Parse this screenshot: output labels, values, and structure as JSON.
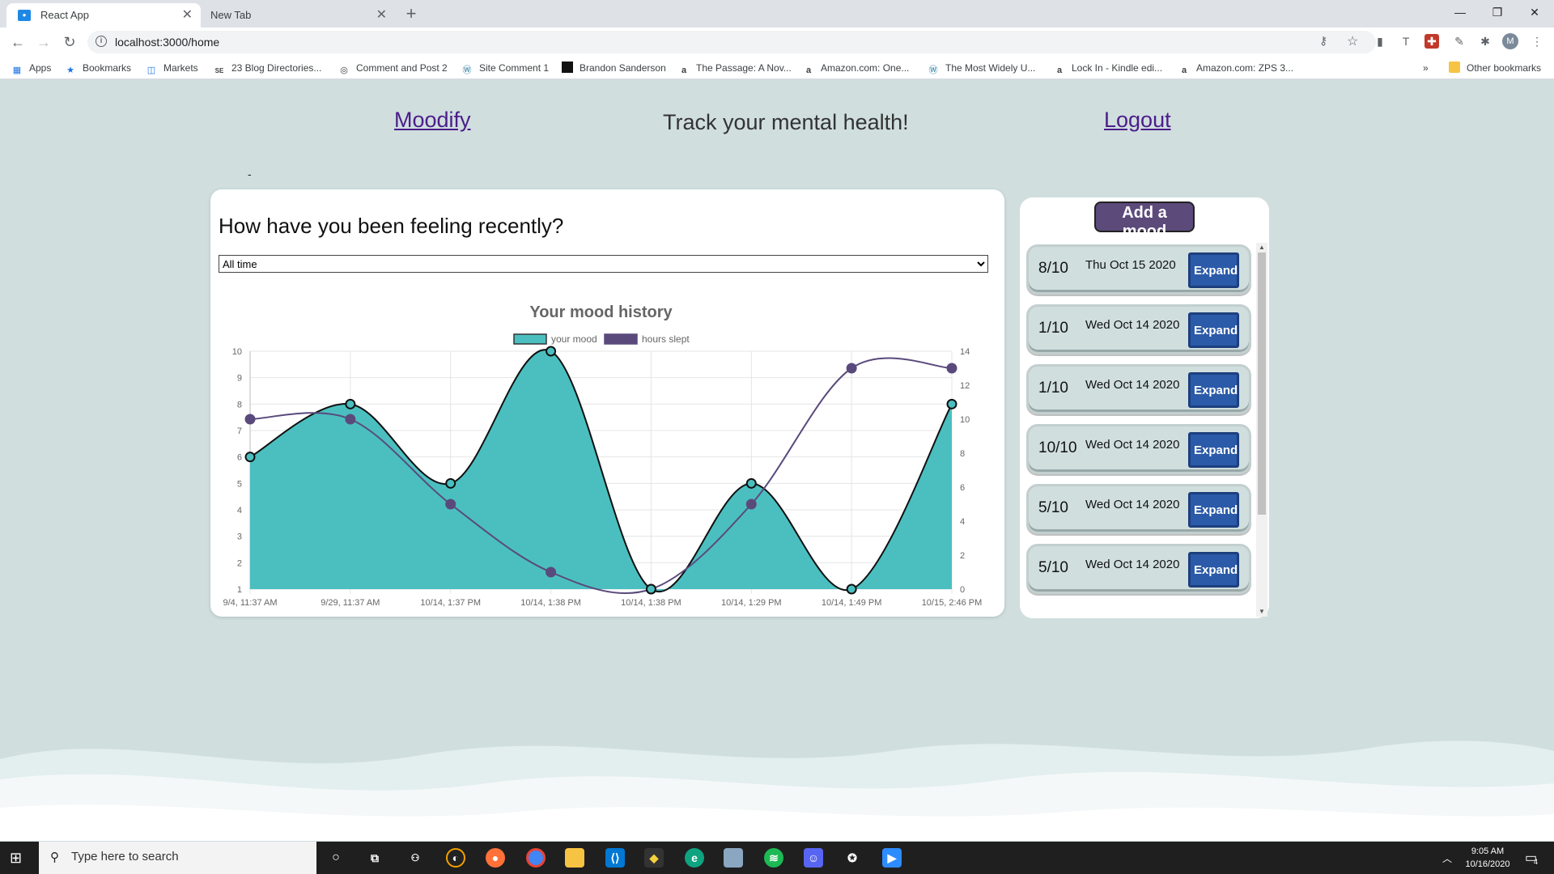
{
  "browser": {
    "tabs": [
      {
        "title": "React App",
        "active": true
      },
      {
        "title": "New Tab",
        "active": false
      }
    ],
    "url": "localhost:3000/home",
    "bookmarks": [
      {
        "label": "Apps",
        "icon": "apps-grid-icon"
      },
      {
        "label": "Bookmarks",
        "icon": "star-icon"
      },
      {
        "label": "Markets",
        "icon": "markets-icon"
      },
      {
        "label": "23 Blog Directories...",
        "icon": "seo-icon"
      },
      {
        "label": "Comment and Post 2",
        "icon": "globe-icon"
      },
      {
        "label": "Site Comment 1",
        "icon": "wordpress-icon"
      },
      {
        "label": "Brandon Sanderson",
        "icon": "black-square-icon"
      },
      {
        "label": "The Passage: A Nov...",
        "icon": "amazon-icon"
      },
      {
        "label": "Amazon.com: One...",
        "icon": "amazon-icon"
      },
      {
        "label": "The Most Widely U...",
        "icon": "wordpress-icon"
      },
      {
        "label": "Lock In - Kindle edi...",
        "icon": "amazon-icon"
      },
      {
        "label": "Amazon.com: ZPS 3...",
        "icon": "amazon-icon"
      }
    ],
    "bookmarks_overflow": "»",
    "other_bookmarks": "Other bookmarks",
    "profile_initial": "M"
  },
  "header": {
    "brand": "Moodify",
    "tagline": "Track your mental health!",
    "logout": "Logout",
    "stray_mark": "-"
  },
  "main": {
    "question": "How have you been feeling recently?",
    "range_selected": "All time"
  },
  "chart_data": {
    "type": "line",
    "title": "Your mood history",
    "categories": [
      "9/4, 11:37 AM",
      "9/29, 11:37 AM",
      "10/14, 1:37 PM",
      "10/14, 1:38 PM",
      "10/14, 1:38 PM",
      "10/14, 1:29 PM",
      "10/14, 1:49 PM",
      "10/15, 2:46 PM"
    ],
    "series": [
      {
        "name": "your mood",
        "values": [
          6,
          8,
          5,
          10,
          1,
          5,
          1,
          8
        ],
        "color": "#4bbfc0",
        "fill": true,
        "axis": "left"
      },
      {
        "name": "hours slept",
        "values": [
          10,
          10,
          5,
          1,
          0,
          5,
          13,
          13
        ],
        "color": "#5a4a7c",
        "fill": false,
        "axis": "right"
      }
    ],
    "ylim_left": [
      1,
      10
    ],
    "ylim_right": [
      0,
      14
    ],
    "yticks_left": [
      "1",
      "2",
      "3",
      "4",
      "5",
      "6",
      "7",
      "8",
      "9",
      "10"
    ],
    "yticks_right": [
      "0",
      "2",
      "4",
      "6",
      "8",
      "10",
      "12",
      "14"
    ],
    "legend_position": "top",
    "grid": true
  },
  "side": {
    "add_label": "Add a mood",
    "expand_label": "Expand",
    "moods": [
      {
        "score": "8/10",
        "date": "Thu Oct 15 2020"
      },
      {
        "score": "1/10",
        "date": "Wed Oct 14 2020"
      },
      {
        "score": "1/10",
        "date": "Wed Oct 14 2020"
      },
      {
        "score": "10/10",
        "date": "Wed Oct 14 2020"
      },
      {
        "score": "5/10",
        "date": "Wed Oct 14 2020"
      },
      {
        "score": "5/10",
        "date": "Wed Oct 14 2020"
      }
    ]
  },
  "taskbar": {
    "search_placeholder": "Type here to search",
    "time": "9:05 AM",
    "date": "10/16/2020",
    "notification_count": "4"
  }
}
